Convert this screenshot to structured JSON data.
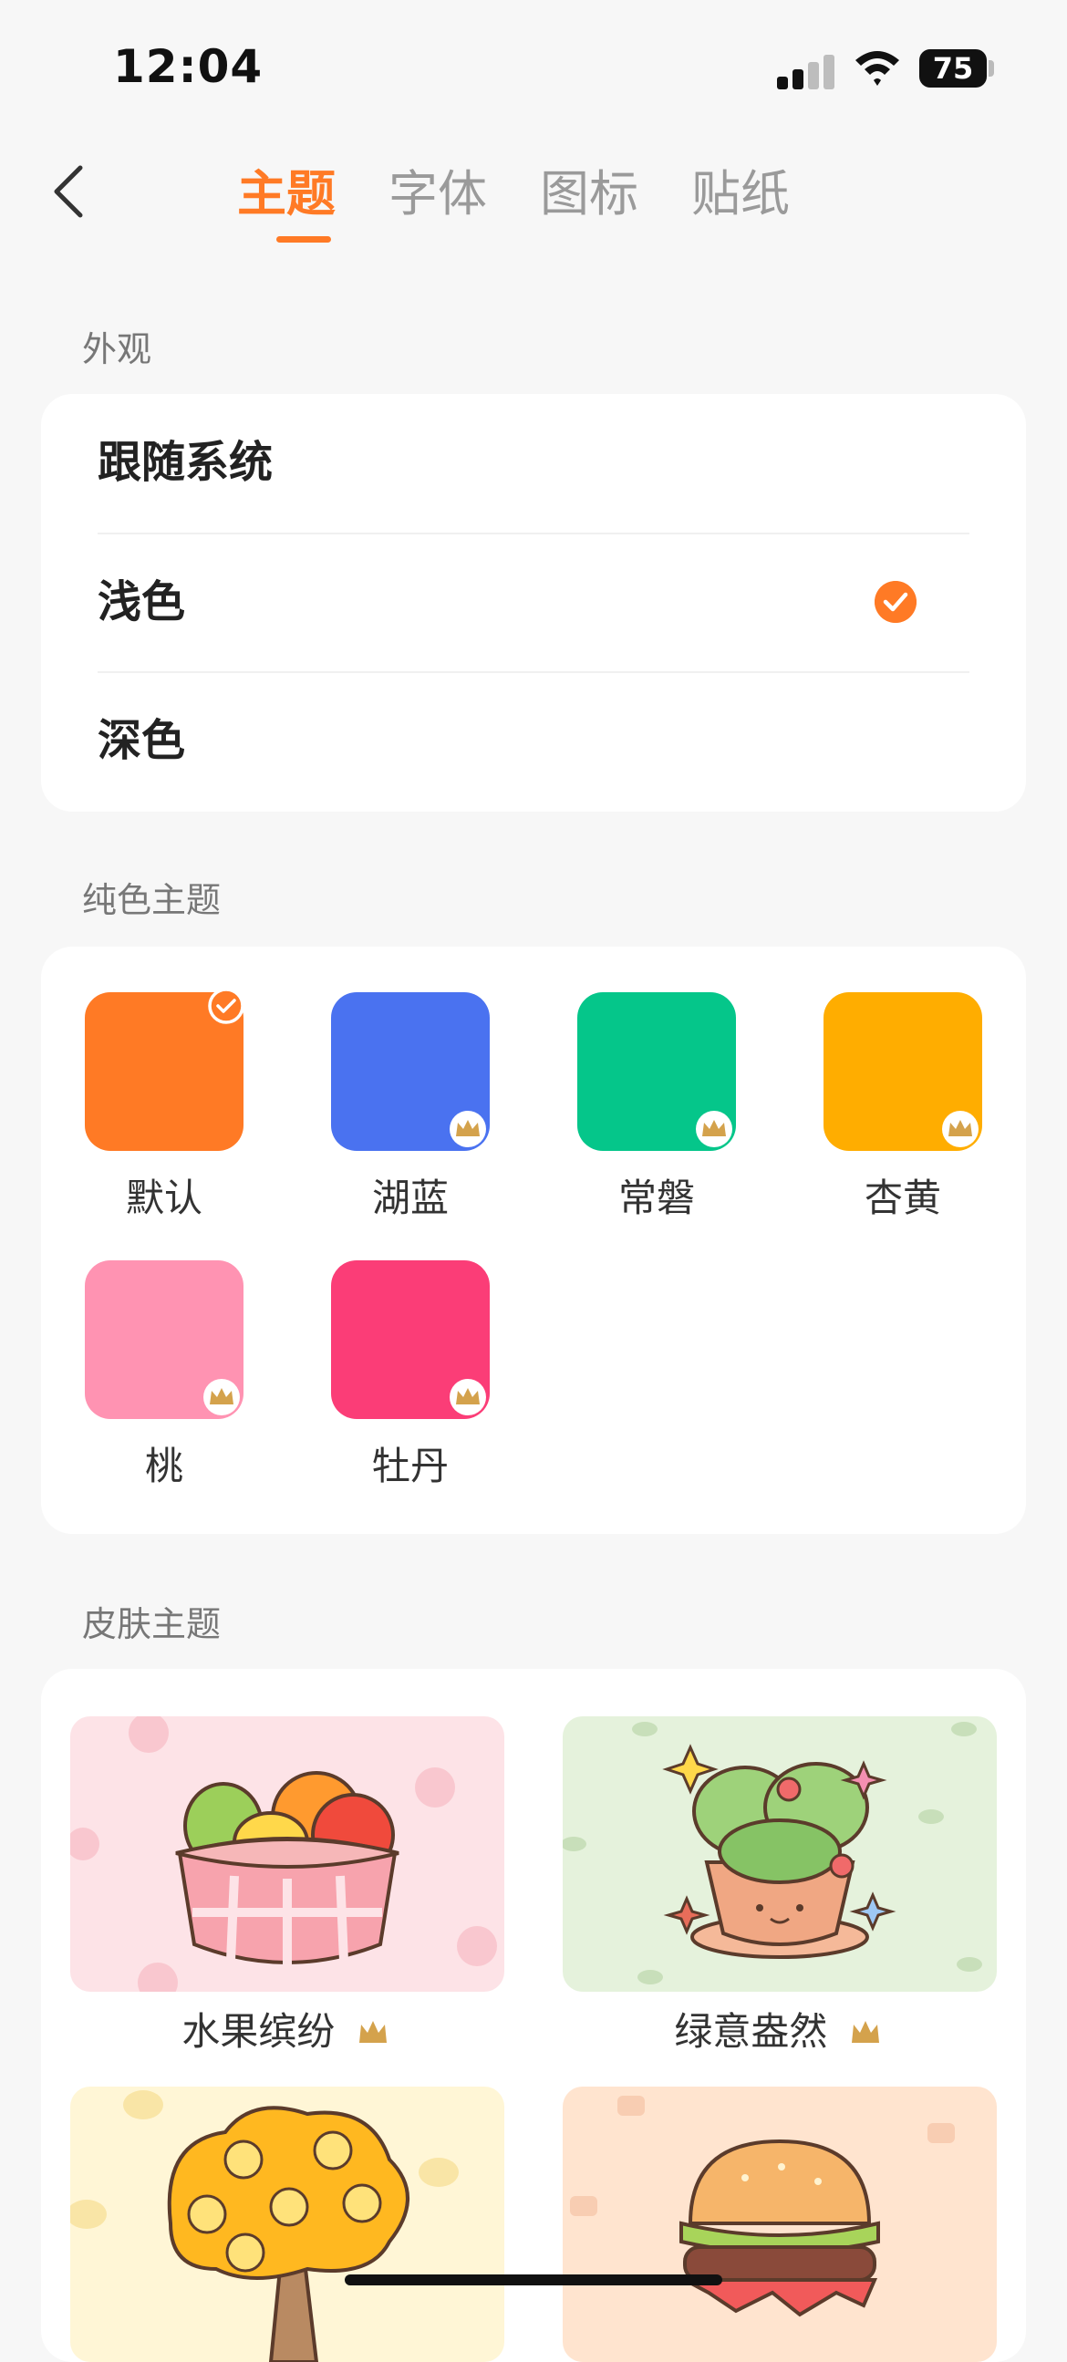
{
  "status": {
    "time": "12:04",
    "battery": "75"
  },
  "tabs": [
    {
      "label": "主题",
      "active": true
    },
    {
      "label": "字体",
      "active": false
    },
    {
      "label": "图标",
      "active": false
    },
    {
      "label": "贴纸",
      "active": false
    }
  ],
  "appearance": {
    "title": "外观",
    "options": [
      {
        "label": "跟随系统",
        "selected": false
      },
      {
        "label": "浅色",
        "selected": true
      },
      {
        "label": "深色",
        "selected": false
      }
    ]
  },
  "solid_themes": {
    "title": "纯色主题",
    "items": [
      {
        "label": "默认",
        "color": "#ff7a25",
        "selected": true,
        "premium": false
      },
      {
        "label": "湖蓝",
        "color": "#4a72f0",
        "selected": false,
        "premium": true
      },
      {
        "label": "常磐",
        "color": "#05c68a",
        "selected": false,
        "premium": true
      },
      {
        "label": "杏黄",
        "color": "#ffad00",
        "selected": false,
        "premium": true
      },
      {
        "label": "桃",
        "color": "#ff93b2",
        "selected": false,
        "premium": true
      },
      {
        "label": "牡丹",
        "color": "#fb3d77",
        "selected": false,
        "premium": true
      }
    ]
  },
  "skin_themes": {
    "title": "皮肤主题",
    "items": [
      {
        "label": "水果缤纷",
        "bg": "#fde3e7",
        "premium": true
      },
      {
        "label": "绿意盎然",
        "bg": "#e5f2dc",
        "premium": true
      },
      {
        "label": "",
        "bg": "#fff6d6",
        "premium": false
      },
      {
        "label": "",
        "bg": "#ffe4cf",
        "premium": false
      }
    ]
  },
  "colors": {
    "accent": "#ff7a25",
    "crown": "#d4a24c"
  }
}
